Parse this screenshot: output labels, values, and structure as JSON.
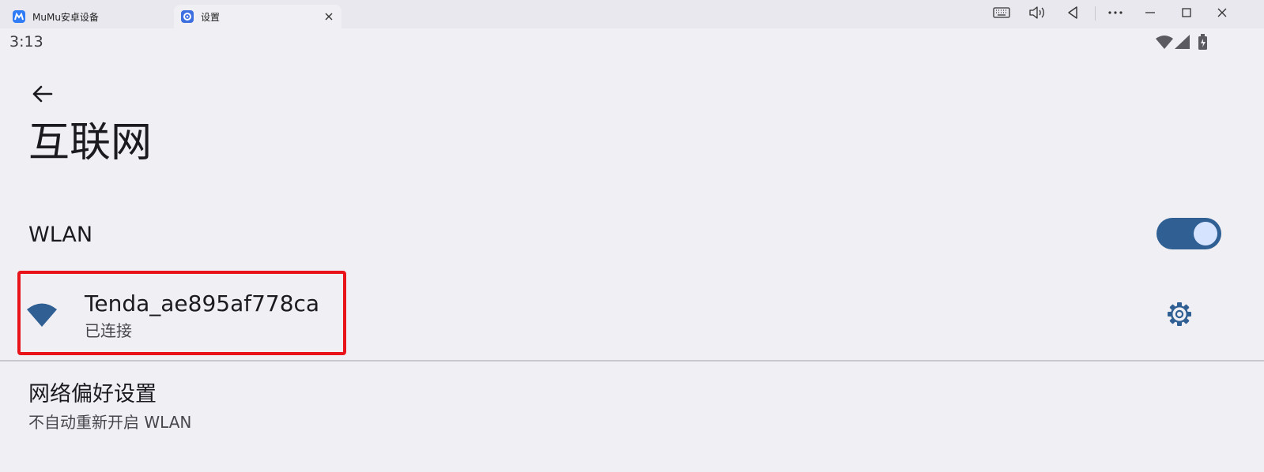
{
  "window": {
    "tabs": [
      {
        "label": "MuMu安卓设备",
        "icon": "mumu-logo-icon",
        "active": false
      },
      {
        "label": "设置",
        "icon": "settings-app-icon",
        "active": true
      }
    ],
    "controls": [
      "keyboard-icon",
      "volume-icon",
      "back-triangle-icon",
      "more-icon",
      "minimize-icon",
      "maximize-icon",
      "close-icon"
    ]
  },
  "status_bar": {
    "time": "3:13",
    "icons": [
      "wifi-signal-icon",
      "cell-signal-icon",
      "battery-charging-icon"
    ]
  },
  "page": {
    "title": "互联网"
  },
  "wlan": {
    "label": "WLAN",
    "enabled": true
  },
  "network": {
    "ssid": "Tenda_ae895af778ca",
    "status": "已连接"
  },
  "preferences": {
    "title": "网络偏好设置",
    "subtitle": "不自动重新开启 WLAN"
  },
  "colors": {
    "accent": "#2f5f93",
    "highlight_box": "#e8141a",
    "background": "#f0eff4"
  }
}
